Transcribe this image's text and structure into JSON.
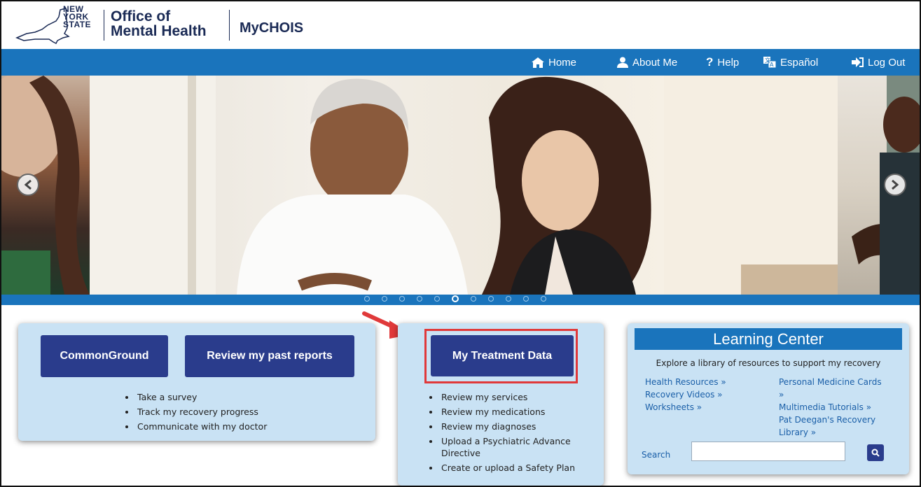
{
  "header": {
    "state_logo": [
      "NEW",
      "YORK",
      "STATE"
    ],
    "agency": [
      "Office of",
      "Mental Health"
    ],
    "app_name": "MyCHOIS"
  },
  "nav": {
    "home": "Home",
    "about": "About Me",
    "help": "Help",
    "espanol": "Español",
    "logout": "Log Out"
  },
  "carousel": {
    "slide_count": 11,
    "active_index": 5
  },
  "commonground": {
    "button": "CommonGround",
    "reports_button": "Review my past reports",
    "items": [
      "Take a survey",
      "Track my recovery progress",
      "Communicate with my doctor"
    ]
  },
  "treatment": {
    "button": "My Treatment Data",
    "items": [
      "Review my services",
      "Review my medications",
      "Review my diagnoses",
      "Upload a Psychiatric Advance Directive",
      "Create or upload a Safety Plan"
    ]
  },
  "learning": {
    "title": "Learning Center",
    "description": "Explore a library of resources to support my recovery",
    "links_left": [
      "Health Resources »",
      "Recovery Videos »",
      "Worksheets »"
    ],
    "links_right": [
      "Personal Medicine Cards »",
      "Multimedia Tutorials »",
      "Pat Deegan's Recovery Library »"
    ],
    "search_label": "Search",
    "search_value": ""
  },
  "colors": {
    "nav_blue": "#1a74bc",
    "navy_button": "#2a3c8c",
    "panel_bg": "#c9e2f4",
    "highlight_red": "#e0393a"
  }
}
